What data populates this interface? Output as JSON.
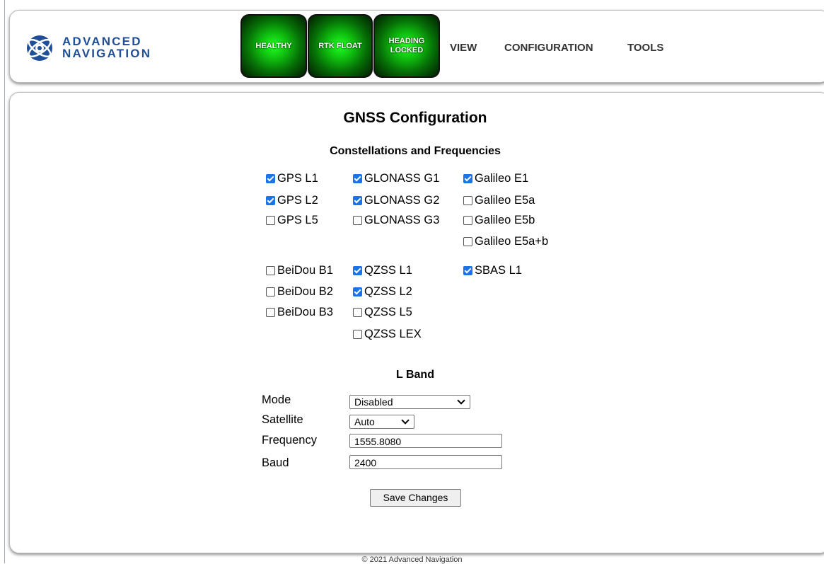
{
  "brand": {
    "line1": "ADVANCED",
    "line2": "NAVIGATION",
    "color": "#1f4f99"
  },
  "status": {
    "healthy": "HEALTHY",
    "rtk": "RTK FLOAT",
    "heading_line1": "HEADING",
    "heading_line2": "LOCKED",
    "color": "#0fbf0f"
  },
  "nav": {
    "view": "VIEW",
    "configuration": "CONFIGURATION",
    "tools": "TOOLS"
  },
  "page": {
    "title": "GNSS Configuration"
  },
  "constellations": {
    "title": "Constellations and Frequencies",
    "items": [
      {
        "label": "GPS L1",
        "checked": true
      },
      {
        "label": "GPS L2",
        "checked": true
      },
      {
        "label": "GPS L5",
        "checked": false
      },
      {
        "label": "GLONASS G1",
        "checked": true
      },
      {
        "label": "GLONASS G2",
        "checked": true
      },
      {
        "label": "GLONASS G3",
        "checked": false
      },
      {
        "label": "Galileo E1",
        "checked": true
      },
      {
        "label": "Galileo E5a",
        "checked": false
      },
      {
        "label": "Galileo E5b",
        "checked": false
      },
      {
        "label": "Galileo E5a+b",
        "checked": false
      },
      {
        "label": "BeiDou B1",
        "checked": false
      },
      {
        "label": "BeiDou B2",
        "checked": false
      },
      {
        "label": "BeiDou B3",
        "checked": false
      },
      {
        "label": "QZSS L1",
        "checked": true
      },
      {
        "label": "QZSS L2",
        "checked": true
      },
      {
        "label": "QZSS L5",
        "checked": false
      },
      {
        "label": "QZSS LEX",
        "checked": false
      },
      {
        "label": "SBAS L1",
        "checked": true
      }
    ]
  },
  "lband": {
    "title": "L Band",
    "mode_label": "Mode",
    "mode_value": "Disabled",
    "satellite_label": "Satellite",
    "satellite_value": "Auto",
    "frequency_label": "Frequency",
    "frequency_value": "1555.8080",
    "baud_label": "Baud",
    "baud_value": "2400"
  },
  "save_label": "Save Changes",
  "footer": "© 2021 Advanced Navigation",
  "colors": {
    "checkbox_checked": "#1a73e8"
  }
}
